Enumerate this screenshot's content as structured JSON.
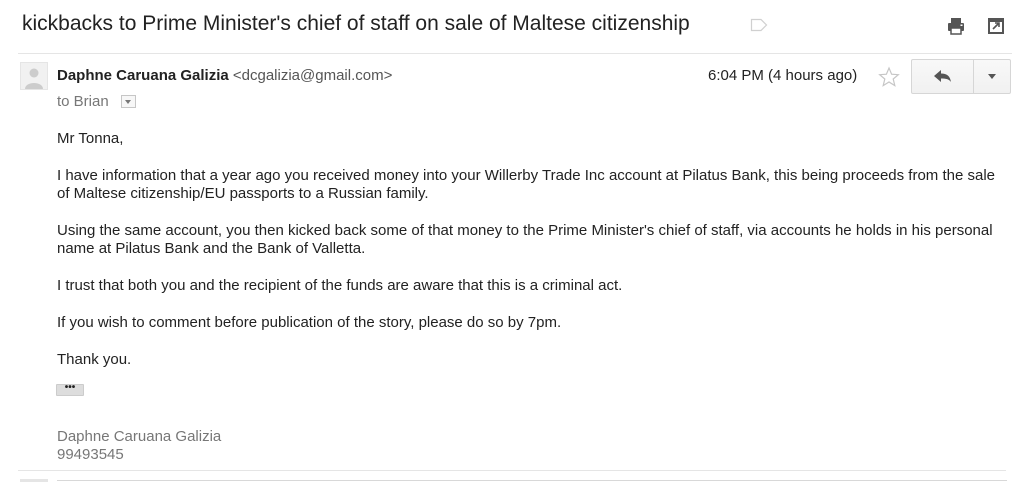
{
  "subject": "kickbacks to Prime Minister's chief of staff on sale of Maltese citizenship",
  "icons": {
    "label": "label-tag-icon",
    "print": "print-icon",
    "new_window": "open-in-new-window-icon",
    "avatar": "person-avatar-icon",
    "star": "star-icon",
    "reply": "reply-arrow-icon",
    "more": "chevron-down-icon",
    "recipient_details": "chevron-down-icon"
  },
  "message": {
    "sender_name": "Daphne Caruana Galizia",
    "sender_email": "<dcgalizia@gmail.com>",
    "to": "to Brian",
    "time": "6:04 PM (4 hours ago)",
    "greeting": "Mr Tonna,",
    "paragraphs": [
      "I have information that a year ago you received money into your Willerby Trade Inc account at Pilatus Bank, this being proceeds from the sale of Maltese citizenship/EU passports to a Russian family.",
      "Using the same account, you then kicked back some of that money to the Prime Minister's chief of staff, via accounts he holds in his personal name at Pilatus Bank and the Bank of Valletta.",
      "I trust that both you and the recipient of the funds are aware that this is a criminal act.",
      "If you wish to comment before publication of the story, please do so by 7pm.",
      "Thank you."
    ],
    "trimmed_content_label": "•••",
    "signature_name": "Daphne Caruana Galizia",
    "signature_phone": "99493545"
  },
  "colors": {
    "text": "#222222",
    "muted": "#777777",
    "divider": "#e5e5e5",
    "button_border": "#d6d6d6"
  }
}
